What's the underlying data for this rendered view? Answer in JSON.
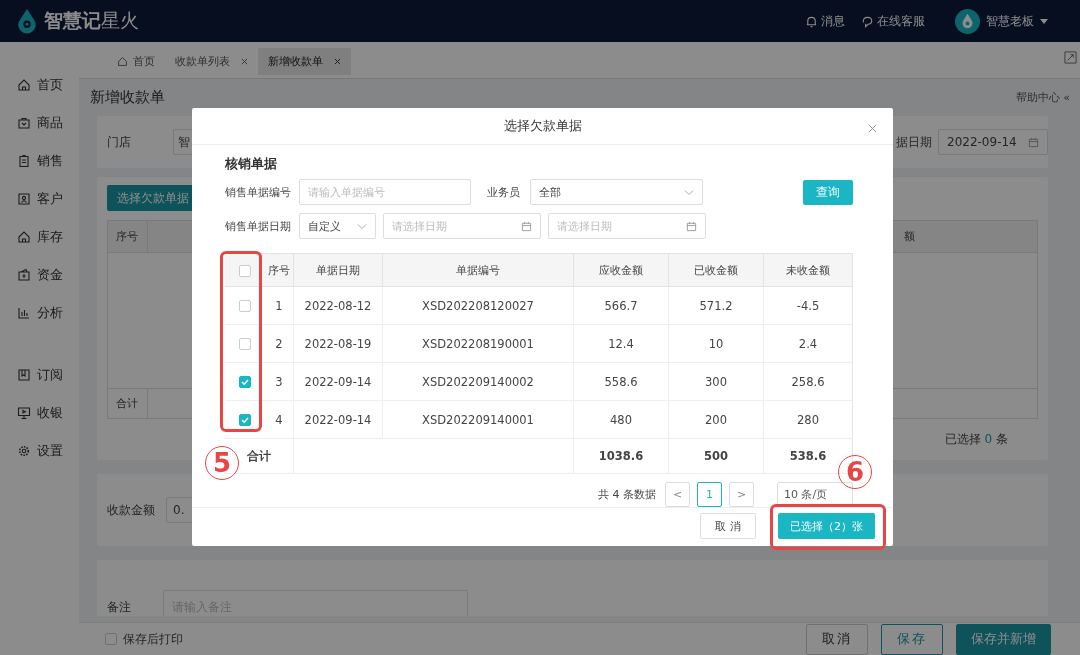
{
  "app": {
    "logo_bold": "智慧记",
    "logo_light": "星火",
    "header_links": [
      {
        "label": "消息"
      },
      {
        "label": "在线客服"
      }
    ],
    "user": "智慧老板"
  },
  "sidebar": {
    "groups": [
      [
        {
          "label": "首页"
        },
        {
          "label": "商品"
        },
        {
          "label": "销售"
        },
        {
          "label": "客户"
        },
        {
          "label": "库存"
        },
        {
          "label": "资金"
        },
        {
          "label": "分析"
        }
      ],
      [
        {
          "label": "订阅"
        },
        {
          "label": "收银"
        },
        {
          "label": "设置"
        }
      ]
    ]
  },
  "tabs": [
    {
      "label": "首页",
      "closable": false,
      "selected": false
    },
    {
      "label": "收款单列表",
      "closable": true,
      "selected": false
    },
    {
      "label": "新增收款单",
      "closable": true,
      "selected": true
    }
  ],
  "page": {
    "title": "新增收款单",
    "help": "帮助中心 «"
  },
  "form": {
    "store_label": "门店",
    "store_value": "智",
    "date_label": "据日期",
    "date_value": "2022-09-14"
  },
  "detail": {
    "button": "选择欠款单据",
    "columns": [
      "序号",
      "额"
    ],
    "total_label": "合计",
    "selected_prefix": "已选择",
    "selected_count": "0",
    "selected_suffix": "条"
  },
  "amount": {
    "label": "收款金额",
    "value": "0."
  },
  "remark": {
    "label": "备注",
    "placeholder": "请输入备注"
  },
  "footer": {
    "print_label": "保存后打印",
    "print_checked": false,
    "buttons": [
      {
        "label": "取消",
        "kind": "default"
      },
      {
        "label": "保存",
        "kind": "outline"
      },
      {
        "label": "保存并新增",
        "kind": "primary"
      }
    ]
  },
  "dialog": {
    "title": "选择欠款单据",
    "section": "核销单据",
    "filters": {
      "number_label": "销售单据编号",
      "number_placeholder": "请输入单据编号",
      "staff_label": "业务员",
      "staff_value": "全部",
      "query": "查询",
      "date_label": "销售单据日期",
      "date_mode": "自定义",
      "start_placeholder": "请选择日期",
      "end_placeholder": "请选择日期"
    },
    "table": {
      "all_checked": false,
      "columns": [
        "序号",
        "单据日期",
        "单据编号",
        "应收金额",
        "已收金额",
        "未收金额"
      ],
      "rows": [
        {
          "checked": false,
          "cells": [
            "1",
            "2022-08-12",
            "XSD202208120027",
            "566.7",
            "571.2",
            "-4.5"
          ]
        },
        {
          "checked": false,
          "cells": [
            "2",
            "2022-08-19",
            "XSD202208190001",
            "12.4",
            "10",
            "2.4"
          ]
        },
        {
          "checked": true,
          "cells": [
            "3",
            "2022-09-14",
            "XSD202209140002",
            "558.6",
            "300",
            "258.6"
          ]
        },
        {
          "checked": true,
          "cells": [
            "4",
            "2022-09-14",
            "XSD202209140001",
            "480",
            "200",
            "280"
          ]
        }
      ],
      "total_label": "合计",
      "totals": [
        "1038.6",
        "500",
        "538.6"
      ]
    },
    "pagination": {
      "total": "共 4 条数据",
      "prev": "<",
      "page": "1",
      "next": ">",
      "page_size": "10 条/页"
    },
    "cancel": "取 消",
    "confirm": "已选择（2）张"
  },
  "annotations": [
    {
      "label": "5"
    },
    {
      "label": "6"
    }
  ]
}
